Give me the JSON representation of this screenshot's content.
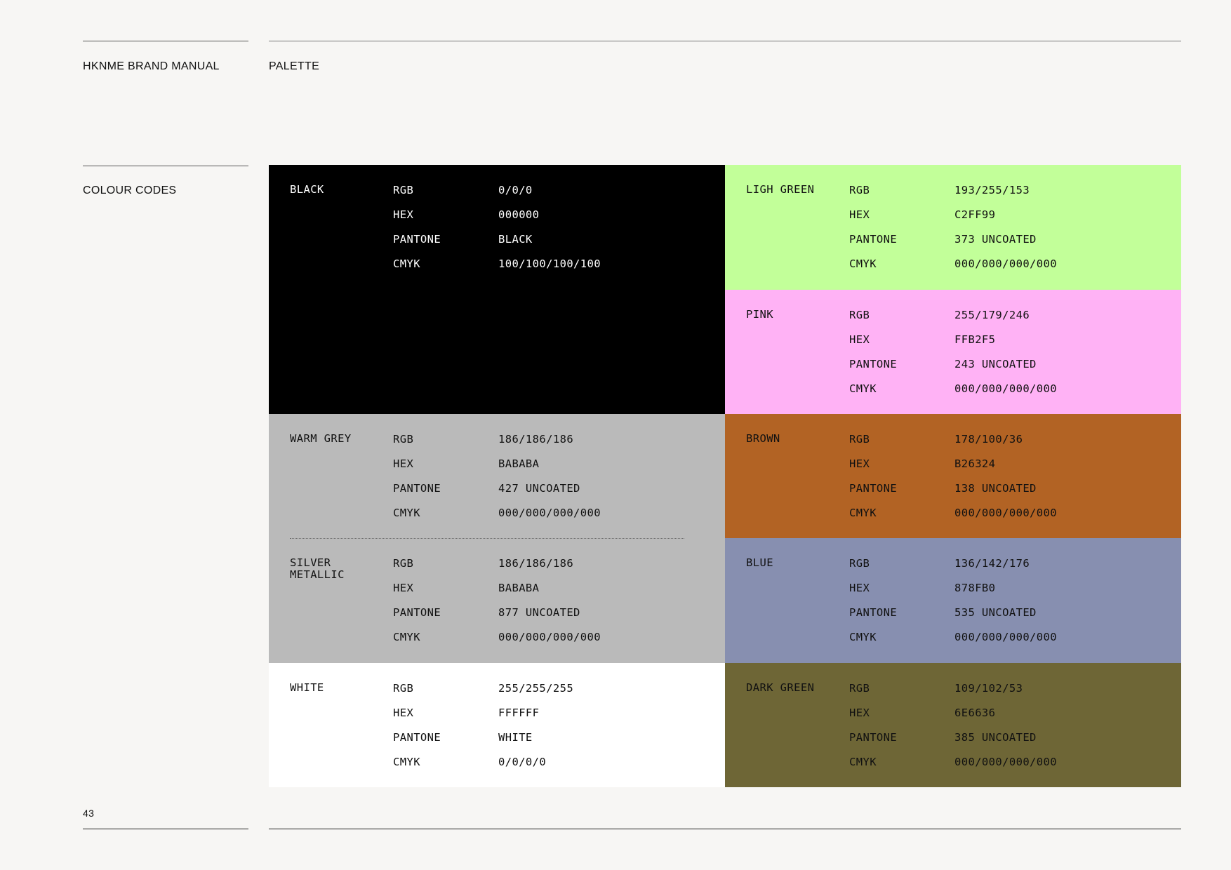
{
  "header": {
    "manual_title": "HKNME BRAND MANUAL",
    "section_title": "PALETTE"
  },
  "sidebar": {
    "section_label": "COLOUR CODES",
    "page_number": "43"
  },
  "swatches": {
    "black": {
      "name": "BLACK",
      "color": "#000000",
      "text_color": "#ffffff",
      "rgb": "0/0/0",
      "hex": "000000",
      "pantone": "BLACK",
      "cmyk": "100/100/100/100"
    },
    "ligh_green": {
      "name": "LIGH GREEN",
      "color": "#C2FF99",
      "text_color": "#111111",
      "rgb": "193/255/153",
      "hex": "C2FF99",
      "pantone": "373 UNCOATED",
      "cmyk": "000/000/000/000"
    },
    "pink": {
      "name": "PINK",
      "color": "#FFB2F5",
      "text_color": "#111111",
      "rgb": "255/179/246",
      "hex": "FFB2F5",
      "pantone": "243 UNCOATED",
      "cmyk": "000/000/000/000"
    },
    "warm_grey": {
      "name": "WARM GREY",
      "color": "#BABABA",
      "text_color": "#111111",
      "rgb": "186/186/186",
      "hex": "BABABA",
      "pantone": "427 UNCOATED",
      "cmyk": "000/000/000/000"
    },
    "silver": {
      "name": "SILVER\nMETALLIC",
      "color": "#BABABA",
      "text_color": "#111111",
      "rgb": "186/186/186",
      "hex": "BABABA",
      "pantone": "877 UNCOATED",
      "cmyk": "000/000/000/000"
    },
    "brown": {
      "name": "BROWN",
      "color": "#B26324",
      "text_color": "#111111",
      "rgb": "178/100/36",
      "hex": "B26324",
      "pantone": "138 UNCOATED",
      "cmyk": "000/000/000/000"
    },
    "blue": {
      "name": "BLUE",
      "color": "#878FB0",
      "text_color": "#111111",
      "rgb": "136/142/176",
      "hex": "878FB0",
      "pantone": "535 UNCOATED",
      "cmyk": "000/000/000/000"
    },
    "white": {
      "name": "WHITE",
      "color": "#FFFFFF",
      "text_color": "#111111",
      "rgb": "255/255/255",
      "hex": "FFFFFF",
      "pantone": "WHITE",
      "cmyk": "0/0/0/0"
    },
    "dark_green": {
      "name": "DARK GREEN",
      "color": "#6E6636",
      "text_color": "#111111",
      "rgb": "109/102/53",
      "hex": "6E6636",
      "pantone": "385 UNCOATED",
      "cmyk": "000/000/000/000"
    }
  },
  "labels": {
    "rgb": "RGB",
    "hex": "HEX",
    "pantone": "PANTONE",
    "cmyk": "CMYK"
  }
}
